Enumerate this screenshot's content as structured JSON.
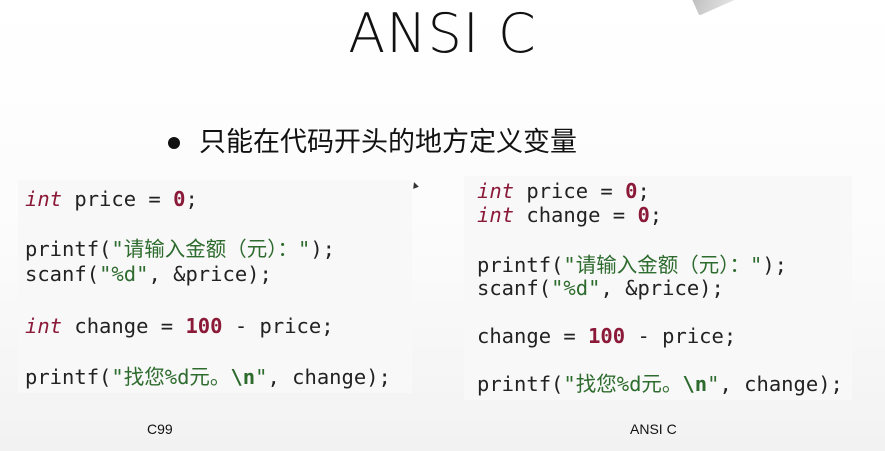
{
  "slide": {
    "title": "ANSI C",
    "bullet": "只能在代码开头的地方定义变量"
  },
  "left_panel": {
    "caption": "C99",
    "lines": [
      {
        "kw": "int",
        "a": " price = ",
        "num": "0",
        "b": ";"
      },
      {
        "a": "printf(",
        "str": "\"请输入金额（元）：\"",
        "b": ");"
      },
      {
        "a": "scanf(",
        "str": "\"%d\"",
        "b": ", &price);"
      },
      {
        "kw": "int",
        "a": " change = ",
        "num": "100",
        "b": " - price;"
      },
      {
        "a": "printf(",
        "str1": "\"找您%d元。",
        "esc": "\\n",
        "str2": "\"",
        "b": ", change);"
      }
    ]
  },
  "right_panel": {
    "caption": "ANSI C",
    "lines": [
      {
        "kw": "int",
        "a": " price = ",
        "num": "0",
        "b": ";"
      },
      {
        "kw": "int",
        "a": " change = ",
        "num": "0",
        "b": ";"
      },
      {
        "a": "printf(",
        "str": "\"请输入金额（元）：\"",
        "b": ");"
      },
      {
        "a": "scanf(",
        "str": "\"%d\"",
        "b": ", &price);"
      },
      {
        "a": "change = ",
        "num": "100",
        "b": " - price;"
      },
      {
        "a": "printf(",
        "str1": "\"找您%d元。",
        "esc": "\\n",
        "str2": "\"",
        "b": ", change);"
      }
    ]
  },
  "colors": {
    "keyword": "#8b1a39",
    "string": "#2e6b2e",
    "code_background": "#f8f8f8"
  }
}
